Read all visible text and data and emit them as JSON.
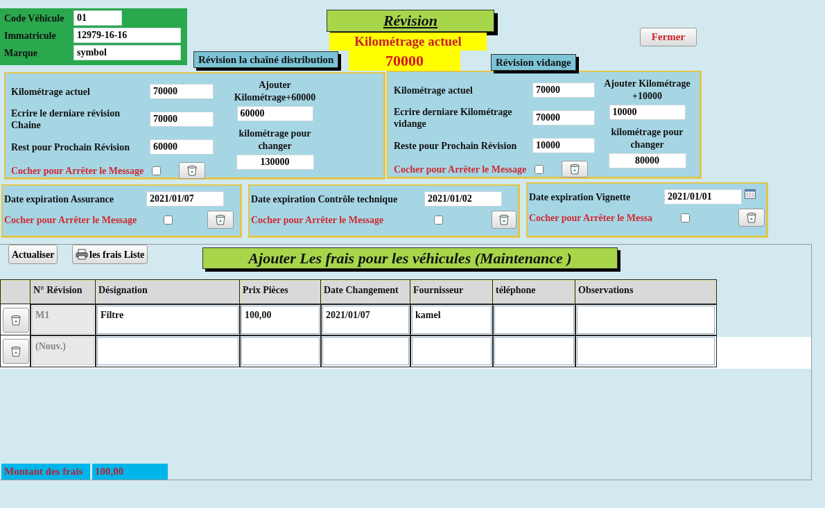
{
  "vehicle": [
    {
      "label": "Code Véhicule",
      "value": "01"
    },
    {
      "label": "Immatricule",
      "value": "12979-16-16"
    },
    {
      "label": "Marque",
      "value": "symbol"
    }
  ],
  "title": "Révision",
  "km_label": "Kilométrage actuel",
  "km_value": "70000",
  "close_button": "Fermer",
  "revisions": [
    {
      "heading": "Révision la chaîné distribution",
      "rows": [
        {
          "label": "Kilométrage actuel",
          "value": "70000"
        },
        {
          "label": "Ecrire le derniare révision Chaine",
          "value": "70000"
        },
        {
          "label": "Rest pour Prochain Révision",
          "value": "60000"
        }
      ],
      "add_label": "Ajouter Kilométrage+60000",
      "add_value": "60000",
      "change_label": "kilométrage pour changer",
      "change_value": "130000",
      "stop_label": "Cocher pour Arrêter le Message",
      "stop_checked": false
    },
    {
      "heading": "Révision vidange",
      "rows": [
        {
          "label": "Kilométrage actuel",
          "value": "70000"
        },
        {
          "label": "Ecrire derniare Kilométrage vidange",
          "value": "70000"
        },
        {
          "label": "Reste pour Prochain Révision",
          "value": "10000"
        }
      ],
      "add_label": "Ajouter Kilométrage +10000",
      "add_value": "10000",
      "change_label": "kilométrage pour changer",
      "change_value": "80000",
      "stop_label": "Cocher pour Arrêter le Message",
      "stop_checked": false
    }
  ],
  "expirations": [
    {
      "label": "Date expiration Assurance",
      "value": "2021/01/07",
      "stop_label": "Cocher pour Arrêter le Message",
      "stop_checked": false,
      "calendar": false
    },
    {
      "label": "Date expiration  Contrôle technique",
      "value": "2021/01/02",
      "stop_label": "Cocher pour Arrêter le Message",
      "stop_checked": false,
      "calendar": false
    },
    {
      "label": "Date expiration Vignette",
      "value": "2021/01/01",
      "stop_label": "Cocher pour Arrêter le Messa",
      "stop_checked": false,
      "calendar": true
    }
  ],
  "toolbar": {
    "refresh": "Actualiser",
    "list": "les frais Liste"
  },
  "section_title": "Ajouter Les frais pour les véhicules (Maintenance )",
  "table": {
    "columns": [
      "N° Révision",
      "Désignation",
      "Prix Pièces",
      "Date Changement",
      "Fournisseur",
      "téléphone",
      "Observations"
    ],
    "rows": [
      {
        "kind": "record",
        "cells": [
          "M1",
          "Filtre",
          "100,00",
          "2021/01/07",
          "kamel",
          "",
          ""
        ]
      },
      {
        "kind": "new",
        "cells": [
          "(Nouv.)",
          "",
          "",
          "",
          "",
          "",
          ""
        ]
      }
    ]
  },
  "total": {
    "label": "Montant des frais",
    "value": "100,00"
  }
}
